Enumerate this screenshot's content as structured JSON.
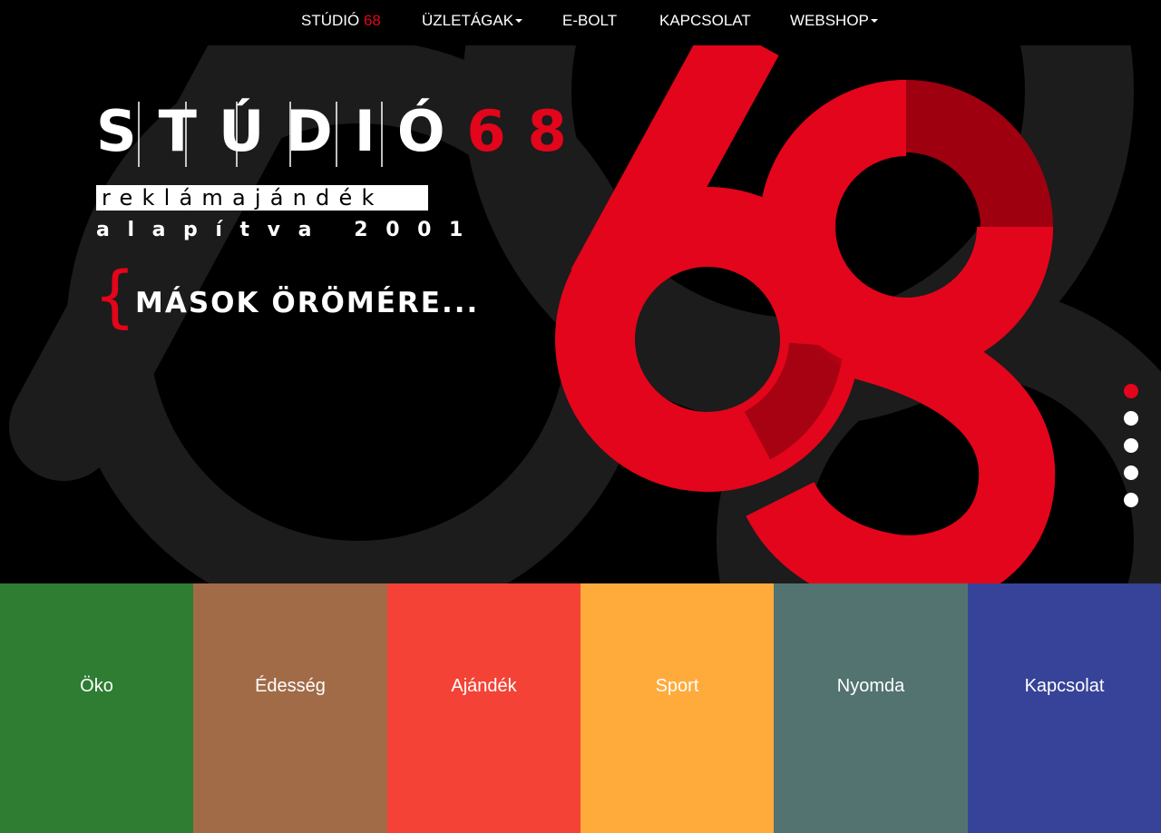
{
  "nav": {
    "items": [
      {
        "label": "STÚDIÓ ",
        "accent": "68",
        "has_dropdown": false
      },
      {
        "label": "ÜZLETÁGAK",
        "has_dropdown": true
      },
      {
        "label": "E-BOLT",
        "has_dropdown": false
      },
      {
        "label": "KAPCSOLAT",
        "has_dropdown": false
      },
      {
        "label": "WEBSHOP",
        "has_dropdown": true
      }
    ]
  },
  "hero": {
    "logo_word": "STÚDIÓ",
    "logo_number": "68",
    "tagline": "reklámajándék",
    "founded": "alapítva 2001",
    "slogan_brace": "{",
    "slogan": "MÁSOK ÖRÖMÉRE...",
    "big_number": "68",
    "slide_count": 5,
    "active_slide": 1
  },
  "tiles": [
    {
      "label": "Öko",
      "color": "#2e7d32"
    },
    {
      "label": "Édesség",
      "color": "#a16b47"
    },
    {
      "label": "Ajándék",
      "color": "#f44336"
    },
    {
      "label": "Sport",
      "color": "#ffab3b"
    },
    {
      "label": "Nyomda",
      "color": "#527370"
    },
    {
      "label": "Kapcsolat",
      "color": "#364398"
    }
  ],
  "colors": {
    "brand_red": "#e3051b",
    "background": "#000000",
    "ghost_shape": "#1c1c1c"
  }
}
